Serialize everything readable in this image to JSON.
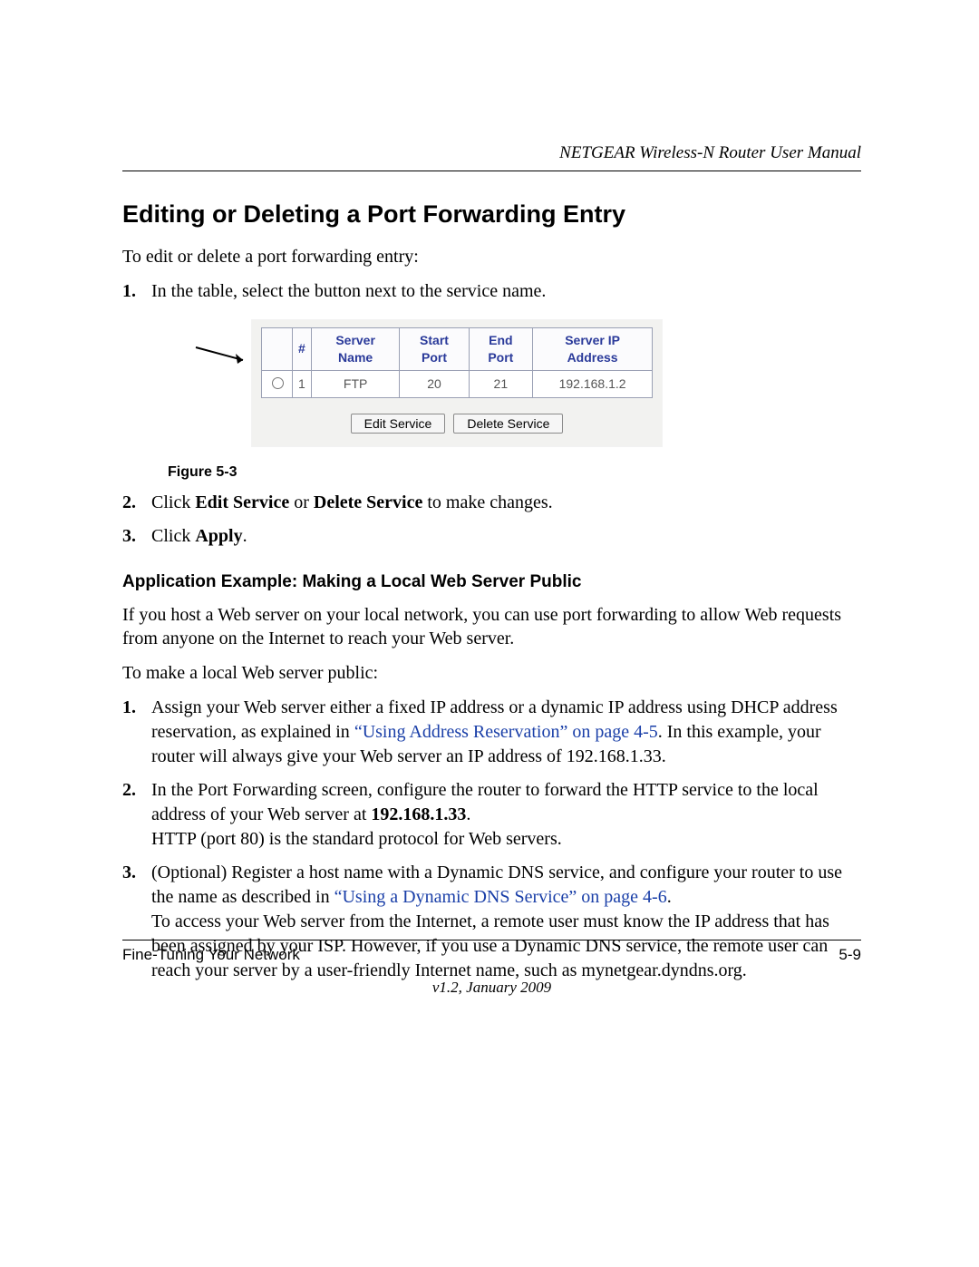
{
  "header": {
    "title": "NETGEAR Wireless-N Router User Manual"
  },
  "heading": "Editing or Deleting a Port Forwarding Entry",
  "intro": "To edit or delete a port forwarding entry:",
  "step1": "In the table, select the button next to the service name.",
  "figure": {
    "caption": "Figure 5-3",
    "table": {
      "headers": {
        "num": "#",
        "server_name": "Server Name",
        "start_port": "Start Port",
        "end_port": "End Port",
        "server_ip": "Server IP Address"
      },
      "row": {
        "num": "1",
        "server_name": "FTP",
        "start_port": "20",
        "end_port": "21",
        "server_ip": "192.168.1.2"
      }
    },
    "buttons": {
      "edit": "Edit Service",
      "delete": "Delete Service"
    }
  },
  "step2": {
    "pre": "Click ",
    "b1": "Edit Service",
    "mid": " or ",
    "b2": "Delete Service",
    "post": " to make changes."
  },
  "step3": {
    "pre": "Click ",
    "b1": "Apply",
    "post": "."
  },
  "subheading": "Application Example: Making a Local Web Server Public",
  "sub_intro": "If you host a Web server on your local network, you can use port forwarding to allow Web requests from anyone on the Internet to reach your Web server.",
  "sub_intro2": "To make a local Web server public:",
  "lstep1": {
    "t1": "Assign your Web server either a fixed IP address or a dynamic IP address using DHCP address reservation, as explained in ",
    "link": "“Using Address Reservation” on page 4-5",
    "t2": ". In this example, your router will always give your Web server an IP address of 192.168.1.33."
  },
  "lstep2": {
    "t1": "In the Port Forwarding screen, configure the router to forward the HTTP service to the local address of your Web server at ",
    "b1": "192.168.1.33",
    "t2": ".",
    "t3": "HTTP (port 80) is the standard protocol for Web servers."
  },
  "lstep3": {
    "t1": "(Optional) Register a host name with a Dynamic DNS service, and configure your router to use the name as described in ",
    "link": "“Using a Dynamic DNS Service” on page 4-6",
    "t2": ".",
    "t3": "To access your Web server from the Internet, a remote user must know the IP address that has been assigned by your ISP. However, if you use a Dynamic DNS service, the remote user can reach your server by a user-friendly Internet name, such as mynetgear.dyndns.org."
  },
  "footer": {
    "left": "Fine-Tuning Your Network",
    "right": "5-9",
    "version": "v1.2, January 2009"
  }
}
